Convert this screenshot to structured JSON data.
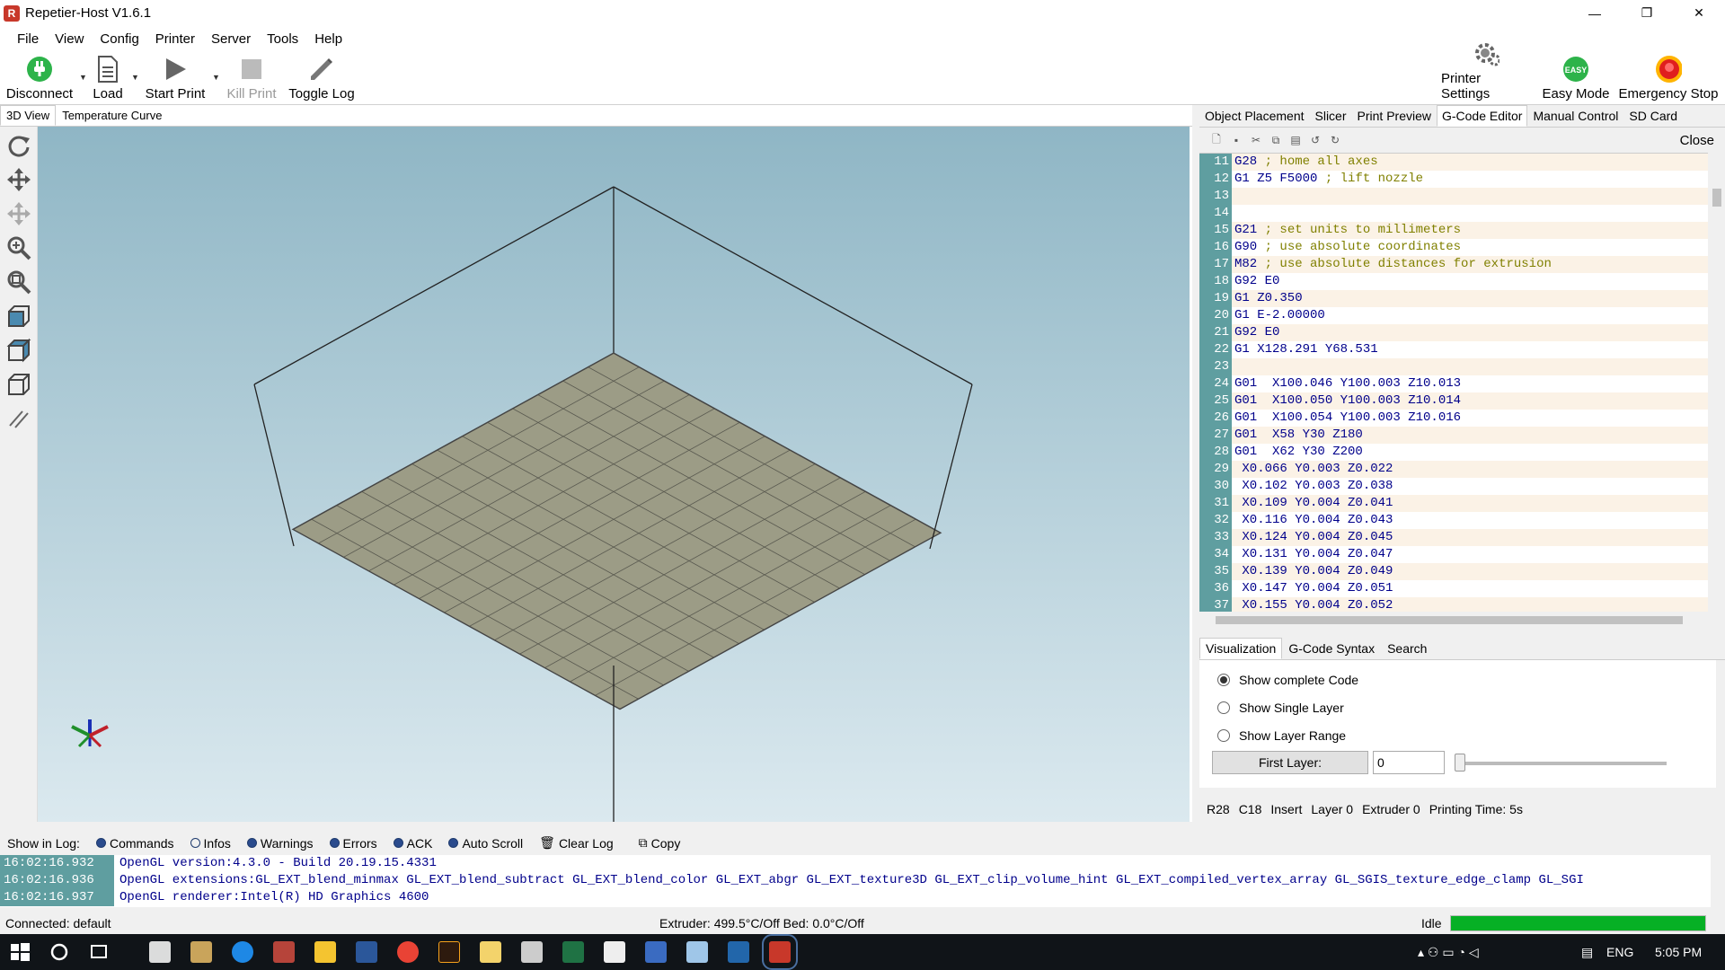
{
  "window": {
    "title": "Repetier-Host V1.6.1",
    "controls": [
      "—",
      "❐",
      "✕"
    ]
  },
  "menu": [
    "File",
    "View",
    "Config",
    "Printer",
    "Server",
    "Tools",
    "Help"
  ],
  "toolbar": {
    "disconnect": "Disconnect",
    "load": "Load",
    "start_print": "Start Print",
    "kill_print": "Kill Print",
    "toggle_log": "Toggle Log",
    "printer_settings": "Printer Settings",
    "easy_mode": "Easy Mode",
    "easy_badge": "EASY",
    "emergency_stop": "Emergency Stop"
  },
  "left_tabs": [
    "3D View",
    "Temperature Curve"
  ],
  "right_tabs": [
    "Object Placement",
    "Slicer",
    "Print Preview",
    "G-Code Editor",
    "Manual Control",
    "SD Card"
  ],
  "editor": {
    "close_label": "Close",
    "lines": [
      {
        "n": "11",
        "cmd": "G28",
        "comment": " ; home all axes"
      },
      {
        "n": "12",
        "cmd": "G1 Z5 F5000",
        "comment": " ; lift nozzle"
      },
      {
        "n": "13",
        "cmd": "",
        "comment": ""
      },
      {
        "n": "14",
        "cmd": "",
        "comment": ""
      },
      {
        "n": "15",
        "cmd": "G21",
        "comment": " ; set units to millimeters"
      },
      {
        "n": "16",
        "cmd": "G90",
        "comment": " ; use absolute coordinates"
      },
      {
        "n": "17",
        "cmd": "M82",
        "comment": " ; use absolute distances for extrusion"
      },
      {
        "n": "18",
        "cmd": "G92 E0",
        "comment": ""
      },
      {
        "n": "19",
        "cmd": "G1 Z0.350",
        "comment": ""
      },
      {
        "n": "20",
        "cmd": "G1 E-2.00000",
        "comment": ""
      },
      {
        "n": "21",
        "cmd": "G92 E0",
        "comment": ""
      },
      {
        "n": "22",
        "cmd": "G1 X128.291 Y68.531",
        "comment": ""
      },
      {
        "n": "23",
        "cmd": "",
        "comment": ""
      },
      {
        "n": "24",
        "cmd": "G01  X100.046 Y100.003 Z10.013",
        "comment": ""
      },
      {
        "n": "25",
        "cmd": "G01  X100.050 Y100.003 Z10.014",
        "comment": ""
      },
      {
        "n": "26",
        "cmd": "G01  X100.054 Y100.003 Z10.016",
        "comment": ""
      },
      {
        "n": "27",
        "cmd": "G01  X58 Y30 Z180",
        "comment": ""
      },
      {
        "n": "28",
        "cmd": "G01  X62 Y30 Z200",
        "comment": ""
      },
      {
        "n": "29",
        "cmd": " X0.066 Y0.003 Z0.022",
        "comment": ""
      },
      {
        "n": "30",
        "cmd": " X0.102 Y0.003 Z0.038",
        "comment": ""
      },
      {
        "n": "31",
        "cmd": " X0.109 Y0.004 Z0.041",
        "comment": ""
      },
      {
        "n": "32",
        "cmd": " X0.116 Y0.004 Z0.043",
        "comment": ""
      },
      {
        "n": "33",
        "cmd": " X0.124 Y0.004 Z0.045",
        "comment": ""
      },
      {
        "n": "34",
        "cmd": " X0.131 Y0.004 Z0.047",
        "comment": ""
      },
      {
        "n": "35",
        "cmd": " X0.139 Y0.004 Z0.049",
        "comment": ""
      },
      {
        "n": "36",
        "cmd": " X0.147 Y0.004 Z0.051",
        "comment": ""
      },
      {
        "n": "37",
        "cmd": " X0.155 Y0.004 Z0.052",
        "comment": ""
      }
    ]
  },
  "sub_tabs": [
    "Visualization",
    "G-Code Syntax",
    "Search"
  ],
  "visualization": {
    "options": [
      "Show complete Code",
      "Show Single Layer",
      "Show Layer Range"
    ],
    "selected": 0,
    "first_layer_label": "First Layer:",
    "first_layer_value": "0"
  },
  "editor_status": {
    "row": "R28",
    "col": "C18",
    "mode": "Insert",
    "layer": "Layer 0",
    "extruder": "Extruder 0",
    "printing_time": "Printing Time: 5s"
  },
  "log_bar": {
    "label": "Show in Log:",
    "filters": [
      {
        "label": "Commands",
        "on": true
      },
      {
        "label": "Infos",
        "on": false
      },
      {
        "label": "Warnings",
        "on": true
      },
      {
        "label": "Errors",
        "on": true
      },
      {
        "label": "ACK",
        "on": true
      },
      {
        "label": "Auto Scroll",
        "on": true
      }
    ],
    "clear_log": "Clear Log",
    "copy": "Copy"
  },
  "log": [
    {
      "time": "16:02:16.932",
      "msg": "OpenGL version:4.3.0 - Build 20.19.15.4331"
    },
    {
      "time": "16:02:16.936",
      "msg": "OpenGL extensions:GL_EXT_blend_minmax GL_EXT_blend_subtract GL_EXT_blend_color GL_EXT_abgr GL_EXT_texture3D GL_EXT_clip_volume_hint GL_EXT_compiled_vertex_array GL_SGIS_texture_edge_clamp GL_SGI"
    },
    {
      "time": "16:02:16.937",
      "msg": "OpenGL renderer:Intel(R) HD Graphics 4600"
    }
  ],
  "status": {
    "connection": "Connected: default",
    "temps": "Extruder: 499.5°C/Off Bed: 0.0°C/Off",
    "state": "Idle",
    "progress": 1.0
  },
  "taskbar": {
    "lang": "ENG",
    "time": "5:05 PM"
  },
  "colors": {
    "linenum": "#5f9ea0",
    "code": "#00008b",
    "comment": "#808000",
    "progress": "#06b025"
  }
}
